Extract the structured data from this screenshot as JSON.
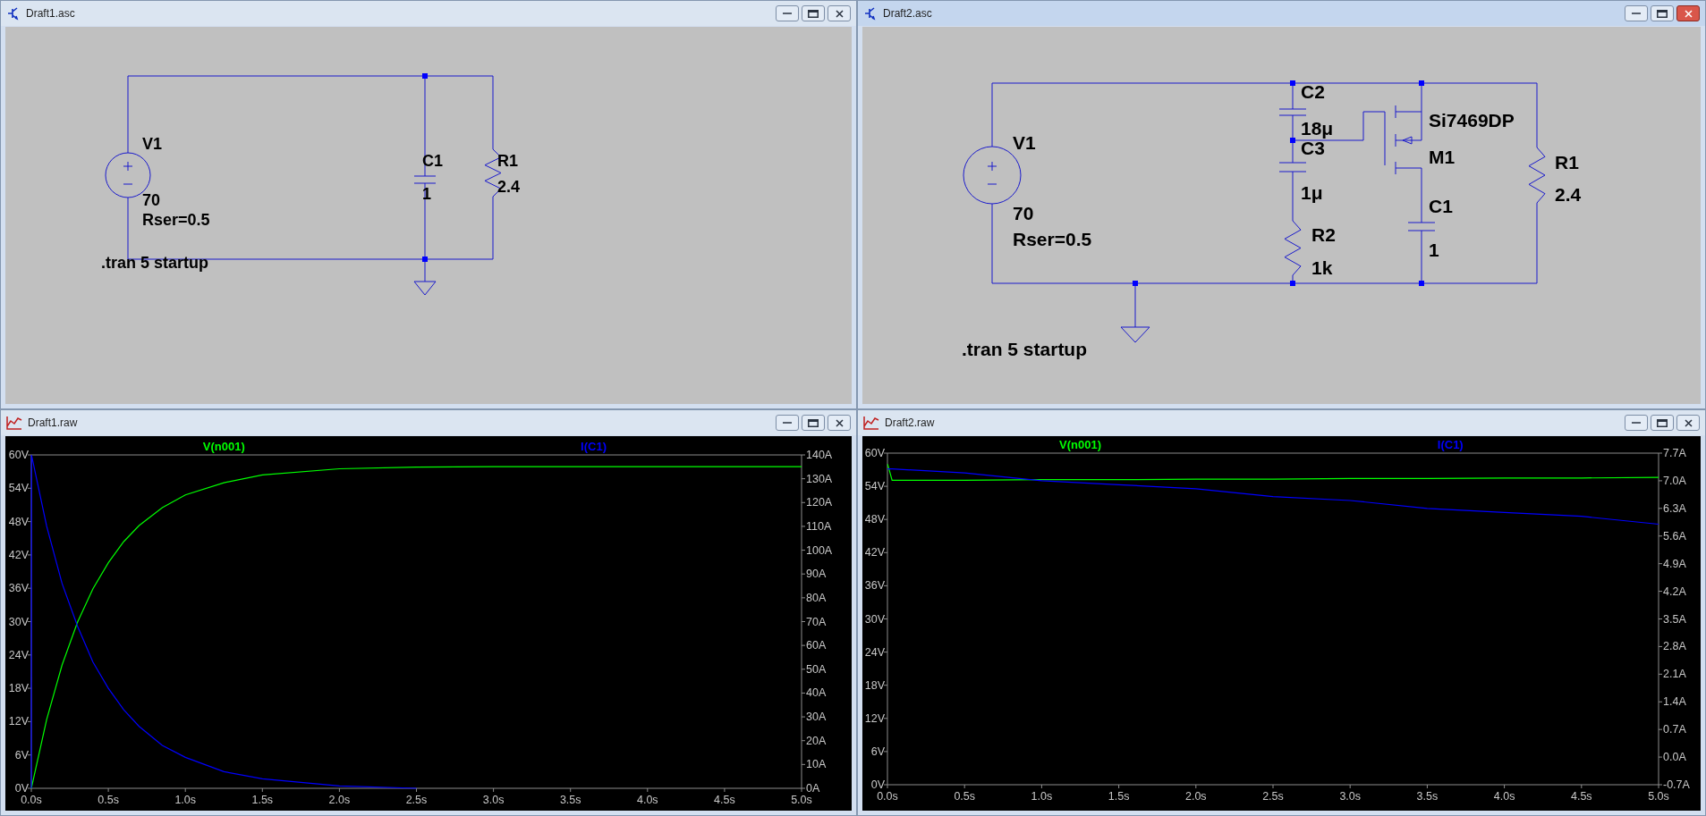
{
  "windows": [
    {
      "kind": "schematic",
      "title": "Draft1.asc",
      "active": false,
      "components": [
        {
          "kind": "voltage-source",
          "labels": [
            "V1",
            "70",
            "Rser=0.5"
          ]
        },
        {
          "kind": "capacitor",
          "labels": [
            "C1",
            "1"
          ]
        },
        {
          "kind": "resistor",
          "labels": [
            "R1",
            "2.4"
          ]
        },
        {
          "kind": "ground"
        }
      ],
      "directive": ".tran 5 startup"
    },
    {
      "kind": "schematic",
      "title": "Draft2.asc",
      "active": true,
      "components": [
        {
          "kind": "voltage-source",
          "labels": [
            "V1",
            "70",
            "Rser=0.5"
          ]
        },
        {
          "kind": "capacitor",
          "labels": [
            "C2",
            "18μ"
          ]
        },
        {
          "kind": "capacitor",
          "labels": [
            "C3",
            "1μ"
          ]
        },
        {
          "kind": "resistor",
          "labels": [
            "R2",
            "1k"
          ]
        },
        {
          "kind": "pmos",
          "labels": [
            "Si7469DP",
            "M1"
          ]
        },
        {
          "kind": "capacitor",
          "labels": [
            "C1",
            "1"
          ]
        },
        {
          "kind": "resistor",
          "labels": [
            "R1",
            "2.4"
          ]
        },
        {
          "kind": "ground"
        }
      ],
      "directive": ".tran 5 startup"
    },
    {
      "kind": "plot",
      "title": "Draft1.raw",
      "active": false,
      "chart_data": {
        "type": "line",
        "x": [
          0,
          0.001,
          0.1,
          0.2,
          0.3,
          0.4,
          0.5,
          0.6,
          0.7,
          0.85,
          1.0,
          1.25,
          1.5,
          2.0,
          2.5,
          3.0,
          4.0,
          5.0
        ],
        "series": [
          {
            "name": "V(n001)",
            "color": "#00ff00",
            "values": [
              0,
              0.1,
              12.4,
              22.2,
              29.9,
              35.9,
              40.6,
              44.4,
              47.3,
              50.5,
              52.8,
              55,
              56.4,
              57.5,
              57.8,
              57.9,
              57.9,
              57.9
            ]
          },
          {
            "name": "I(C1)",
            "color": "#0000ff",
            "axis": "y2",
            "values": [
              0,
              140,
              110,
              86,
              68,
              53,
              42,
              33,
              26,
              18,
              13,
              7,
              4,
              1,
              0,
              null,
              null,
              null
            ]
          }
        ],
        "xlim": [
          0,
          5
        ],
        "ylim": [
          0,
          60
        ],
        "y2lim": [
          0,
          140
        ],
        "xticks": [
          {
            "value": 0,
            "label": "0.0s"
          },
          {
            "value": 0.5,
            "label": "0.5s"
          },
          {
            "value": 1,
            "label": "1.0s"
          },
          {
            "value": 1.5,
            "label": "1.5s"
          },
          {
            "value": 2,
            "label": "2.0s"
          },
          {
            "value": 2.5,
            "label": "2.5s"
          },
          {
            "value": 3,
            "label": "3.0s"
          },
          {
            "value": 3.5,
            "label": "3.5s"
          },
          {
            "value": 4,
            "label": "4.0s"
          },
          {
            "value": 4.5,
            "label": "4.5s"
          },
          {
            "value": 5,
            "label": "5.0s"
          }
        ],
        "yticks": [
          {
            "value": 0,
            "label": "0V"
          },
          {
            "value": 6,
            "label": "6V"
          },
          {
            "value": 12,
            "label": "12V"
          },
          {
            "value": 18,
            "label": "18V"
          },
          {
            "value": 24,
            "label": "24V"
          },
          {
            "value": 30,
            "label": "30V"
          },
          {
            "value": 36,
            "label": "36V"
          },
          {
            "value": 42,
            "label": "42V"
          },
          {
            "value": 48,
            "label": "48V"
          },
          {
            "value": 54,
            "label": "54V"
          },
          {
            "value": 60,
            "label": "60V"
          }
        ],
        "y2ticks": [
          {
            "value": 0,
            "label": "0A"
          },
          {
            "value": 10,
            "label": "10A"
          },
          {
            "value": 20,
            "label": "20A"
          },
          {
            "value": 30,
            "label": "30A"
          },
          {
            "value": 40,
            "label": "40A"
          },
          {
            "value": 50,
            "label": "50A"
          },
          {
            "value": 60,
            "label": "60A"
          },
          {
            "value": 70,
            "label": "70A"
          },
          {
            "value": 80,
            "label": "80A"
          },
          {
            "value": 90,
            "label": "90A"
          },
          {
            "value": 100,
            "label": "100A"
          },
          {
            "value": 110,
            "label": "110A"
          },
          {
            "value": 120,
            "label": "120A"
          },
          {
            "value": 130,
            "label": "130A"
          },
          {
            "value": 140,
            "label": "140A"
          }
        ]
      }
    },
    {
      "kind": "plot",
      "title": "Draft2.raw",
      "active": false,
      "chart_data": {
        "type": "line",
        "x": [
          0.001,
          0.03,
          0.5,
          1.0,
          1.5,
          2.0,
          2.5,
          3.0,
          3.5,
          4.0,
          4.5,
          5.0
        ],
        "series": [
          {
            "name": "V(n001)",
            "color": "#00ff00",
            "values": [
              58,
              55.1,
              55.1,
              55.2,
              55.2,
              55.3,
              55.3,
              55.4,
              55.4,
              55.5,
              55.5,
              55.6
            ]
          },
          {
            "name": "I(C1)",
            "color": "#0000ff",
            "axis": "y2",
            "values": [
              7.3,
              7.3,
              7.2,
              7.0,
              6.9,
              6.8,
              6.6,
              6.5,
              6.3,
              6.2,
              6.1,
              5.9
            ]
          }
        ],
        "xlim": [
          0,
          5
        ],
        "ylim": [
          0,
          60
        ],
        "y2lim": [
          -0.7,
          7.7
        ],
        "xticks": [
          {
            "value": 0,
            "label": "0.0s"
          },
          {
            "value": 0.5,
            "label": "0.5s"
          },
          {
            "value": 1,
            "label": "1.0s"
          },
          {
            "value": 1.5,
            "label": "1.5s"
          },
          {
            "value": 2,
            "label": "2.0s"
          },
          {
            "value": 2.5,
            "label": "2.5s"
          },
          {
            "value": 3,
            "label": "3.0s"
          },
          {
            "value": 3.5,
            "label": "3.5s"
          },
          {
            "value": 4,
            "label": "4.0s"
          },
          {
            "value": 4.5,
            "label": "4.5s"
          },
          {
            "value": 5,
            "label": "5.0s"
          }
        ],
        "yticks": [
          {
            "value": 0,
            "label": "0V"
          },
          {
            "value": 6,
            "label": "6V"
          },
          {
            "value": 12,
            "label": "12V"
          },
          {
            "value": 18,
            "label": "18V"
          },
          {
            "value": 24,
            "label": "24V"
          },
          {
            "value": 30,
            "label": "30V"
          },
          {
            "value": 36,
            "label": "36V"
          },
          {
            "value": 42,
            "label": "42V"
          },
          {
            "value": 48,
            "label": "48V"
          },
          {
            "value": 54,
            "label": "54V"
          },
          {
            "value": 60,
            "label": "60V"
          }
        ],
        "y2ticks": [
          {
            "value": -0.7,
            "label": "-0.7A"
          },
          {
            "value": 0,
            "label": "0.0A"
          },
          {
            "value": 0.7,
            "label": "0.7A"
          },
          {
            "value": 1.4,
            "label": "1.4A"
          },
          {
            "value": 2.1,
            "label": "2.1A"
          },
          {
            "value": 2.8,
            "label": "2.8A"
          },
          {
            "value": 3.5,
            "label": "3.5A"
          },
          {
            "value": 4.2,
            "label": "4.2A"
          },
          {
            "value": 4.9,
            "label": "4.9A"
          },
          {
            "value": 5.6,
            "label": "5.6A"
          },
          {
            "value": 6.3,
            "label": "6.3A"
          },
          {
            "value": 7.0,
            "label": "7.0A"
          },
          {
            "value": 7.7,
            "label": "7.7A"
          }
        ]
      }
    }
  ]
}
